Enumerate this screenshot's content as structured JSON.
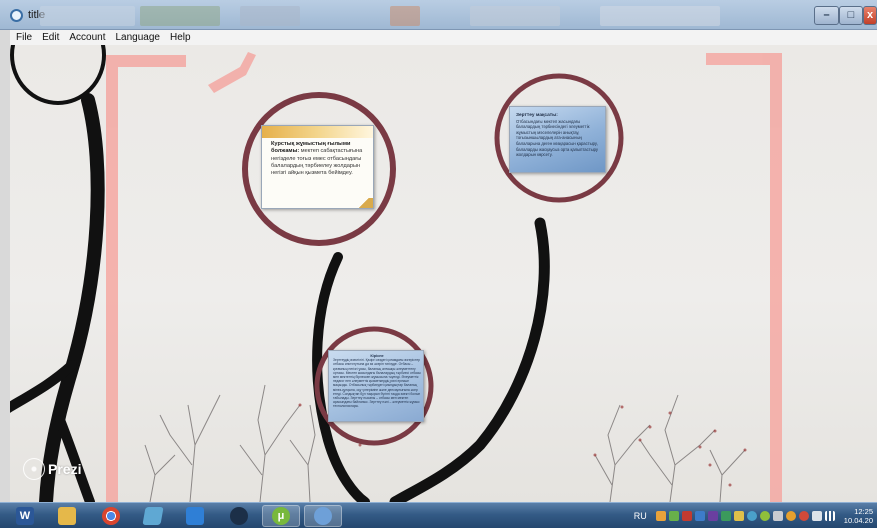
{
  "window": {
    "title": "title",
    "buttons": {
      "minimize": "–",
      "maximize": "□",
      "close": "x"
    }
  },
  "menu": {
    "items": [
      "File",
      "Edit",
      "Account",
      "Language",
      "Help"
    ]
  },
  "cards": {
    "card1": {
      "heading": "Курстық жұмыстың ғылыми болжамы:",
      "body": "мектеп сабақтастығына негізделе тоғыз емес отбасындағы балалардың тәрбиелеу жолдарын негізгі айқын қызмета бейімдеу."
    },
    "card2": {
      "heading": "Зерттеу мақсаты:",
      "body": "Отбасындағы мектеп жасындағы балалардың тәрбиесіндегі әлеуметтік жұмыстың мәселелерін анықтау, тоғызыншылардың ата-анасының балаларына деген көзқарасын қарастыру, балаларды жасқаусыз орта қалыптастыру жолдарын көрсету."
    },
    "card3": {
      "heading": "Кіріспе",
      "body": "Зерттеудің өзектілігі. Қазіргі кездегі қоғамдағы өзгерістер отбасы институтына да өз әсерін тигізуде. Отбасы – қоғамның негізгі ұясы, баланың алғашқы әлеуметтену ортасы. Мектеп жасындағы балалардың тәрбиесі отбасы мен мектептің бірлескен жұмысына тәуелді. Әлеуметтік педагог пен әлеуметтік қызметкердің рөлі ерекше маңызды. Отбасылық тәрбиедегі қиындықтар баланың мінез-құлқына, оқу үлгеріміне және денсаулығына әсер етеді. Сондықтан бұл тақырып бүгінгі таңда өзекті болып табылады. Зерттеу нысаны – отбасы мен мектеп арасындағы байланыс. Зерттеу пәні – әлеуметтік жұмыс технологиялары."
    }
  },
  "logo": {
    "text": "Prezi"
  },
  "taskbar": {
    "apps": [
      {
        "name": "word",
        "glyph": "W",
        "color": "#2b5797"
      },
      {
        "name": "explorer",
        "glyph": "",
        "color": "#e5b84a"
      },
      {
        "name": "chrome",
        "glyph": "",
        "color": "#d9452f"
      },
      {
        "name": "notes",
        "glyph": "",
        "color": "#5fa8d3"
      },
      {
        "name": "media",
        "glyph": "",
        "color": "#2f7fd6"
      },
      {
        "name": "steam",
        "glyph": "",
        "color": "#1c2f48"
      },
      {
        "name": "utorrent",
        "glyph": "μ",
        "color": "#78b83c"
      },
      {
        "name": "prezi",
        "glyph": "",
        "color": "#6ea0d8"
      }
    ],
    "language": "RU",
    "time": "12:25",
    "date": "10.04.20"
  },
  "colors": {
    "accent_ring": "#7a3a44",
    "frame_pink": "#f4a8a2",
    "branch": "#111111"
  }
}
